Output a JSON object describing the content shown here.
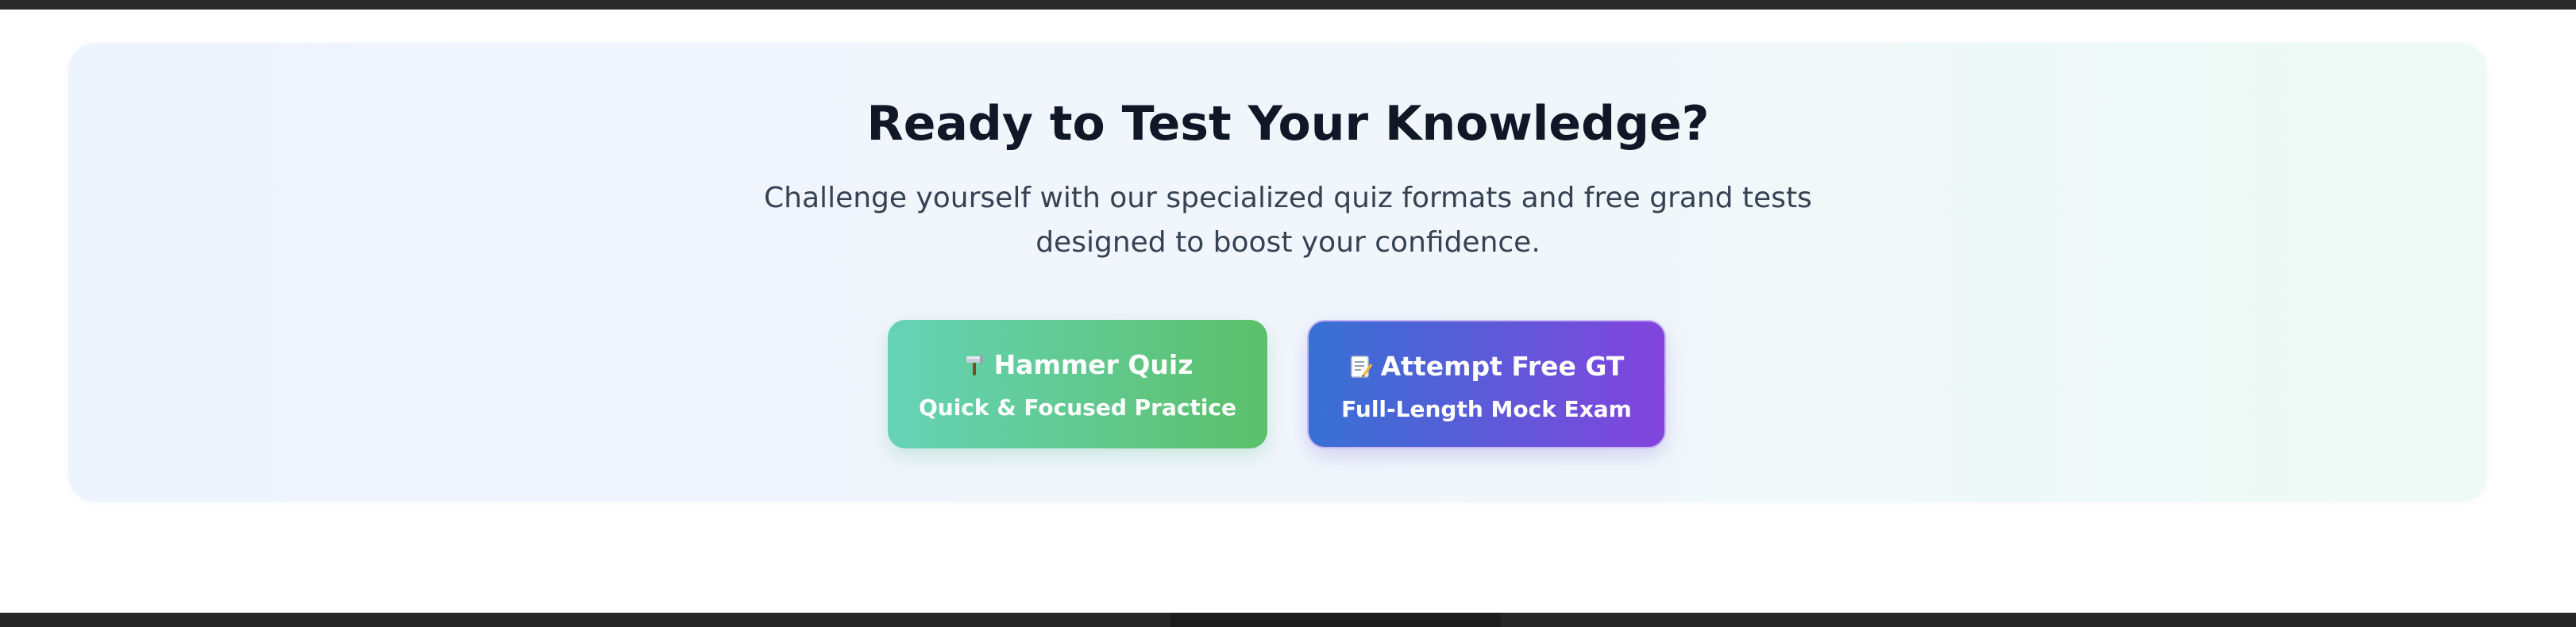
{
  "cta": {
    "title": "Ready to Test Your Knowledge?",
    "subtitle": "Challenge yourself with our specialized quiz formats and free grand tests designed to boost your confidence."
  },
  "buttons": [
    {
      "icon": "hammer-icon",
      "title": "Hammer Quiz",
      "subtitle": "Quick & Focused Practice",
      "gradient": [
        "#66d3b7",
        "#5cc06a"
      ]
    },
    {
      "icon": "memo-icon",
      "title": "Attempt Free GT",
      "subtitle": "Full-Length Mock Exam",
      "gradient": [
        "#3671d4",
        "#8244dd"
      ]
    }
  ],
  "colors": {
    "heading": "#101828",
    "body_text": "#364152",
    "card_background": "#f1f6fc"
  }
}
